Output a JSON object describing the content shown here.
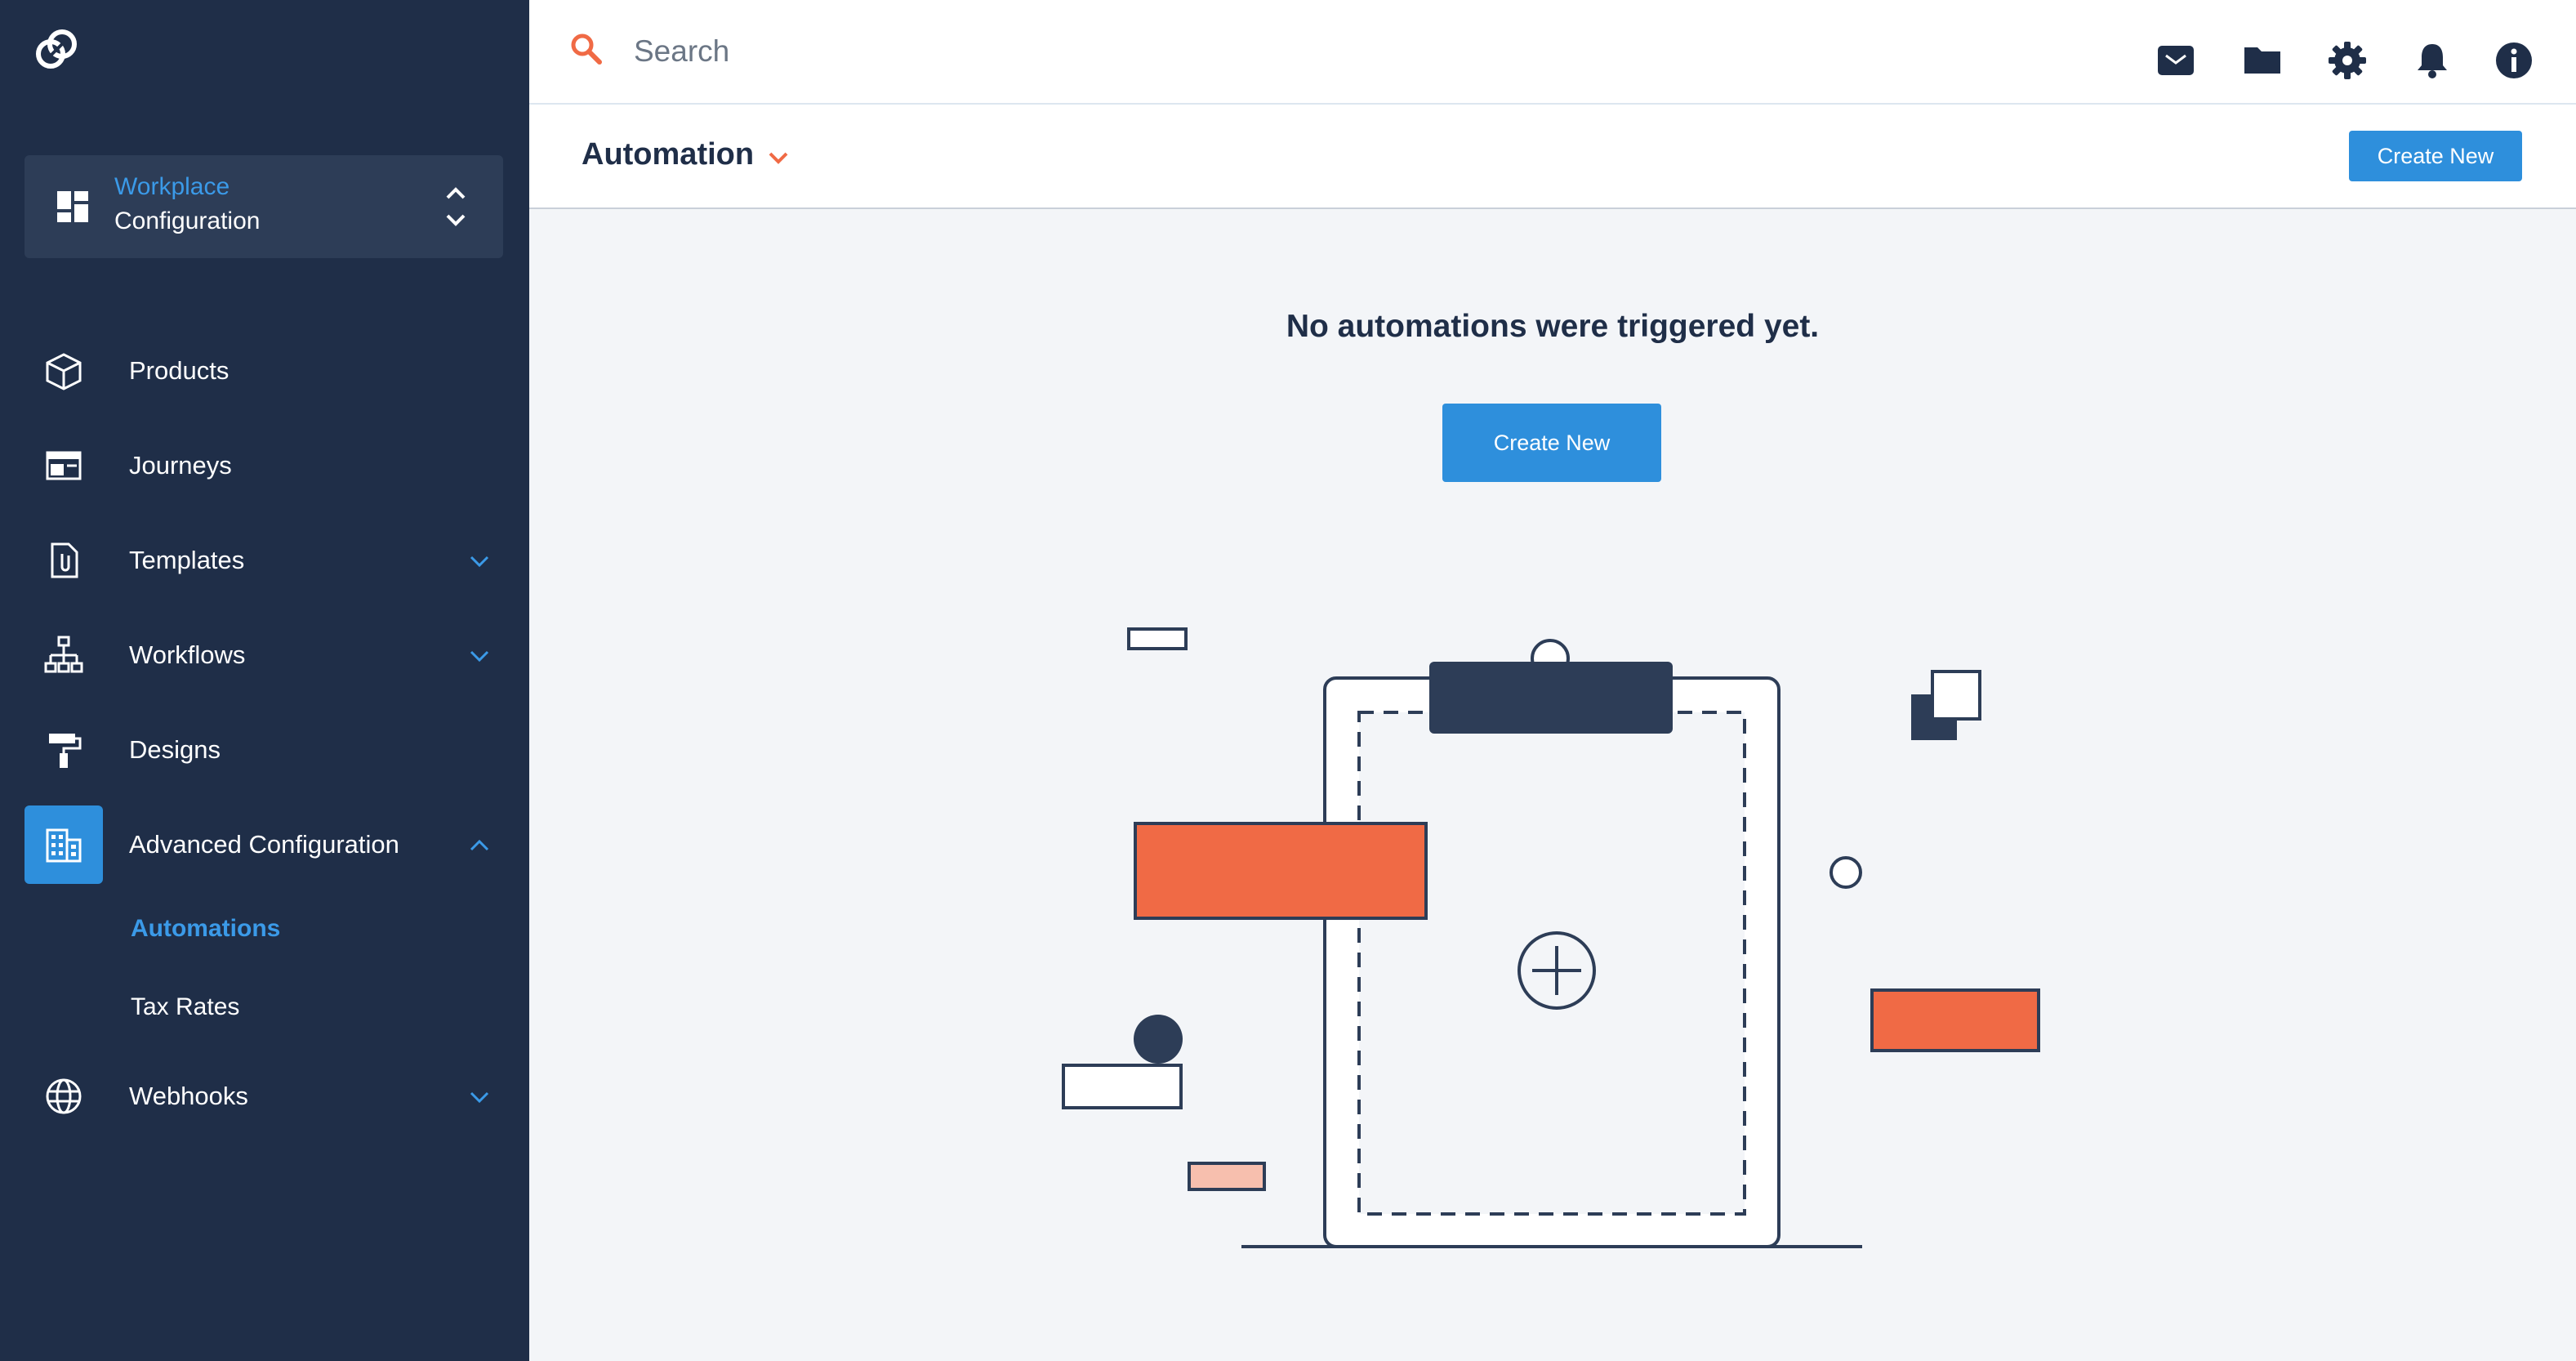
{
  "sidebar": {
    "workspace": {
      "line1": "Workplace",
      "line2": "Configuration"
    },
    "items": [
      {
        "label": "Products",
        "icon": "cube-icon"
      },
      {
        "label": "Journeys",
        "icon": "browser-window-icon"
      },
      {
        "label": "Templates",
        "icon": "document-attachment-icon",
        "expandable": true
      },
      {
        "label": "Workflows",
        "icon": "sitemap-icon",
        "expandable": true
      },
      {
        "label": "Designs",
        "icon": "paint-roller-icon"
      },
      {
        "label": "Advanced Configuration",
        "icon": "building-icon",
        "expanded": true,
        "active": true
      },
      {
        "label": "Webhooks",
        "icon": "globe-icon",
        "expandable": true
      }
    ],
    "sub_items": [
      {
        "label": "Automations",
        "active": true
      },
      {
        "label": "Tax Rates"
      }
    ]
  },
  "topbar": {
    "search_placeholder": "Search",
    "icons": [
      "mail-icon",
      "folder-icon",
      "gear-icon",
      "bell-icon",
      "info-icon"
    ]
  },
  "header": {
    "title": "Automation",
    "create_label": "Create New"
  },
  "main": {
    "empty_message": "No automations were triggered yet.",
    "create_label": "Create New"
  },
  "colors": {
    "sidebar_bg": "#1f2e48",
    "accent": "#2e8fdc",
    "orange": "#f06a45",
    "page_bg": "#f3f5f8"
  }
}
